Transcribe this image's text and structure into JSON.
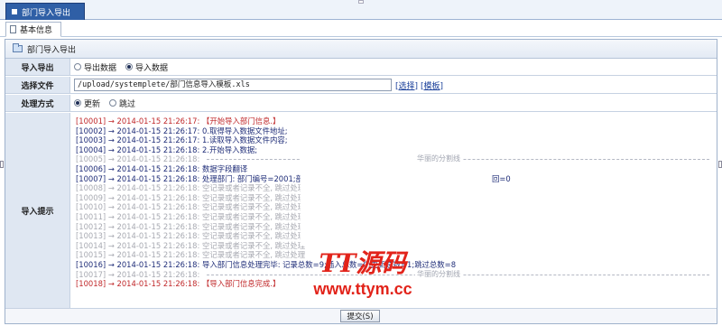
{
  "window": {
    "tab_title": "部门导入导出"
  },
  "subtab": {
    "label": "基本信息"
  },
  "panel": {
    "title": "部门导入导出"
  },
  "form": {
    "mode": {
      "label": "导入导出",
      "options": [
        {
          "label": "导出数据",
          "selected": false
        },
        {
          "label": "导入数据",
          "selected": true
        }
      ]
    },
    "file": {
      "label": "选择文件",
      "value": "/upload/systemplete/部门信息导入模板.xls",
      "choose_link": "[选择]",
      "template_link": "[模板]"
    },
    "method": {
      "label": "处理方式",
      "options": [
        {
          "label": "更新",
          "selected": true
        },
        {
          "label": "跳过",
          "selected": false
        }
      ]
    },
    "log": {
      "label": "导入提示",
      "separator_text": "华丽的分割线",
      "lines": [
        {
          "id": "[10001]",
          "arrow": "→",
          "time": "2014-01-15 21:26:17:",
          "msg": "【开始导入部门信息.】",
          "color": "red"
        },
        {
          "id": "[10002]",
          "arrow": "→",
          "time": "2014-01-15 21:26:17:",
          "msg": "0.取得导入数据文件地址;",
          "color": "navy"
        },
        {
          "id": "[10003]",
          "arrow": "→",
          "time": "2014-01-15 21:26:17:",
          "msg": "1.读取导入数据文件内容;",
          "color": "navy"
        },
        {
          "id": "[10004]",
          "arrow": "→",
          "time": "2014-01-15 21:26:18:",
          "msg": "2.开始导入数据;",
          "color": "navy"
        },
        {
          "id": "[10005]",
          "arrow": "→",
          "time": "2014-01-15 21:26:18:",
          "msg": "",
          "color": "gray",
          "separator": true
        },
        {
          "id": "[10006]",
          "arrow": "→",
          "time": "2014-01-15 21:26:18:",
          "msg": "数据字段翻译",
          "color": "navy"
        },
        {
          "id": "[10007]",
          "arrow": "→",
          "time": "2014-01-15 21:26:18:",
          "msg": "处理部门: 部门编号=2001;部门",
          "tail": "回=0",
          "color": "navy"
        },
        {
          "id": "[10008]",
          "arrow": "→",
          "time": "2014-01-15 21:26:18:",
          "msg": "空记录或者记录不全, 跳过处理",
          "color": "gray"
        },
        {
          "id": "[10009]",
          "arrow": "→",
          "time": "2014-01-15 21:26:18:",
          "msg": "空记录或者记录不全, 跳过处理",
          "color": "gray"
        },
        {
          "id": "[10010]",
          "arrow": "→",
          "time": "2014-01-15 21:26:18:",
          "msg": "空记录或者记录不全, 跳过处理",
          "color": "gray"
        },
        {
          "id": "[10011]",
          "arrow": "→",
          "time": "2014-01-15 21:26:18:",
          "msg": "空记录或者记录不全, 跳过处理",
          "color": "gray"
        },
        {
          "id": "[10012]",
          "arrow": "→",
          "time": "2014-01-15 21:26:18:",
          "msg": "空记录或者记录不全, 跳过处理",
          "color": "gray"
        },
        {
          "id": "[10013]",
          "arrow": "→",
          "time": "2014-01-15 21:26:18:",
          "msg": "空记录或者记录不全, 跳过处理",
          "color": "gray"
        },
        {
          "id": "[10014]",
          "arrow": "→",
          "time": "2014-01-15 21:26:18:",
          "msg": "空记录或者记录不全, 跳过处理",
          "color": "gray"
        },
        {
          "id": "[10015]",
          "arrow": "→",
          "time": "2014-01-15 21:26:18:",
          "msg": "空记录或者记录不全, 跳过处理",
          "color": "gray"
        },
        {
          "id": "[10016]",
          "arrow": "→",
          "time": "2014-01-15 21:26:18:",
          "msg": "导入部门信息处理完毕: 记录总数=9;插入总数=0;更新总数=1;跳过总数=8",
          "color": "navy"
        },
        {
          "id": "[10017]",
          "arrow": "→",
          "time": "2014-01-15 21:26:18:",
          "msg": "",
          "color": "gray",
          "separator": true
        },
        {
          "id": "[10018]",
          "arrow": "→",
          "time": "2014-01-15 21:26:18:",
          "msg": "【导入部门信息完成.】",
          "color": "red"
        }
      ]
    }
  },
  "footer": {
    "submit_label": "提交(S)"
  },
  "watermark": {
    "line1": "TT源码",
    "line2": "www.ttym.cc"
  },
  "colors": {
    "tab_active": "#2f5fa6",
    "log_red": "#c0282a",
    "log_navy": "#1f2d78",
    "log_gray": "#a8aab2",
    "watermark": "#e2231a"
  }
}
